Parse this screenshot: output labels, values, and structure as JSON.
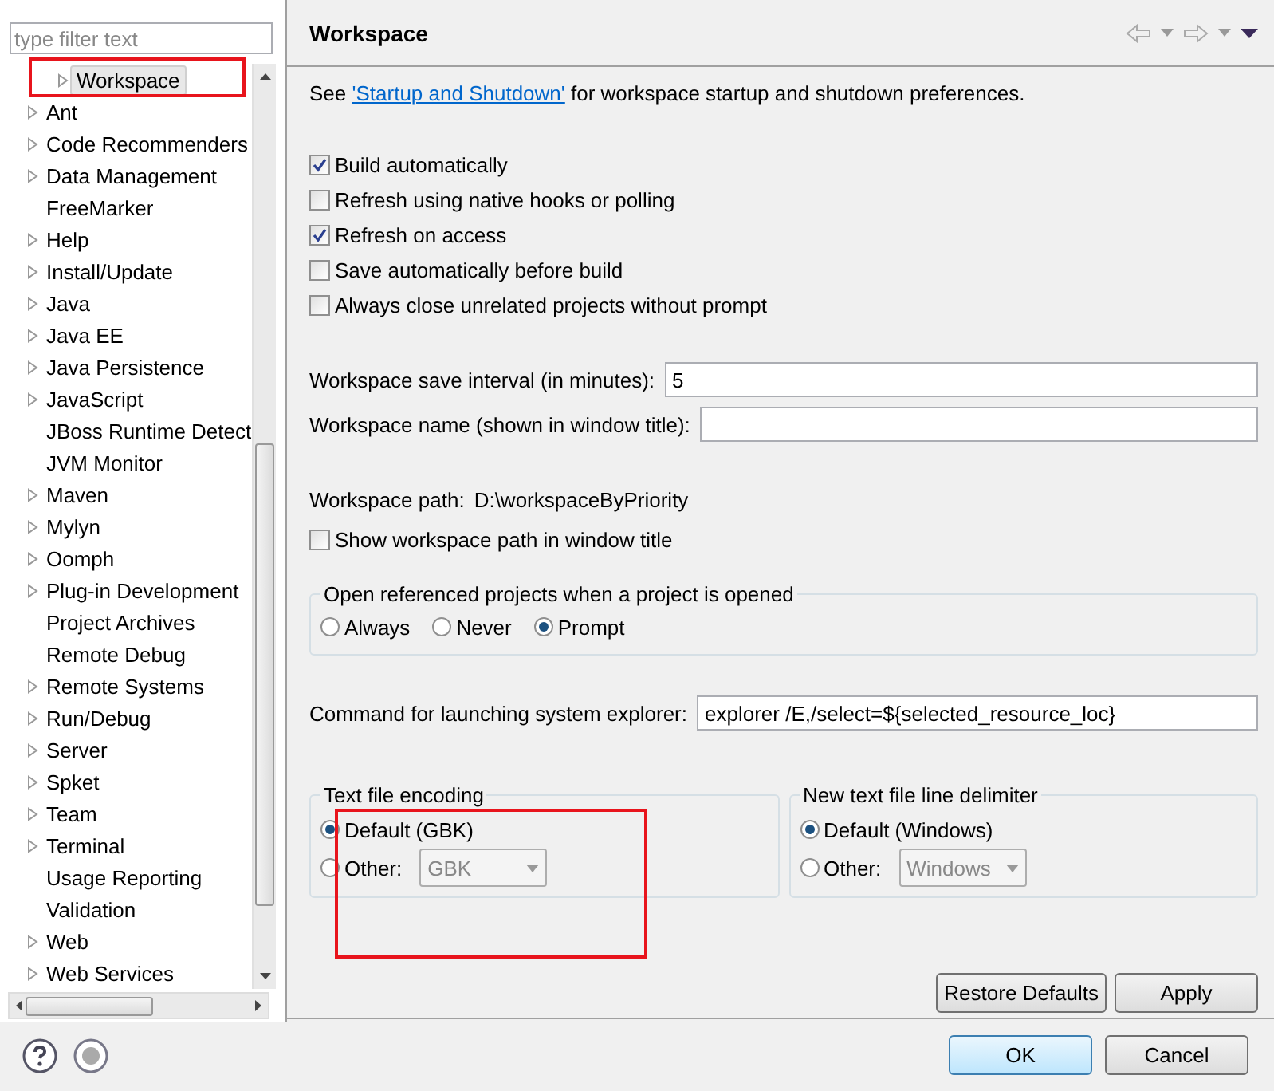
{
  "filter": {
    "placeholder": "type filter text"
  },
  "tree": [
    {
      "children": [
        {
          "label": "Workspace",
          "expandable": true,
          "selected": true
        }
      ]
    },
    {
      "label": "Ant",
      "expandable": true,
      "selected": false
    },
    {
      "label": "Code Recommenders",
      "expandable": true,
      "selected": false
    },
    {
      "label": "Data Management",
      "expandable": true,
      "selected": false
    },
    {
      "label": "FreeMarker",
      "expandable": false,
      "selected": false
    },
    {
      "label": "Help",
      "expandable": true,
      "selected": false
    },
    {
      "label": "Install/Update",
      "expandable": true,
      "selected": false
    },
    {
      "label": "Java",
      "expandable": true,
      "selected": false
    },
    {
      "label": "Java EE",
      "expandable": true,
      "selected": false
    },
    {
      "label": "Java Persistence",
      "expandable": true,
      "selected": false
    },
    {
      "label": "JavaScript",
      "expandable": true,
      "selected": false
    },
    {
      "label": "JBoss Runtime Detect",
      "expandable": false,
      "selected": false
    },
    {
      "label": "JVM Monitor",
      "expandable": false,
      "selected": false
    },
    {
      "label": "Maven",
      "expandable": true,
      "selected": false
    },
    {
      "label": "Mylyn",
      "expandable": true,
      "selected": false
    },
    {
      "label": "Oomph",
      "expandable": true,
      "selected": false
    },
    {
      "label": "Plug-in Development",
      "expandable": true,
      "selected": false
    },
    {
      "label": "Project Archives",
      "expandable": false,
      "selected": false
    },
    {
      "label": "Remote Debug",
      "expandable": false,
      "selected": false
    },
    {
      "label": "Remote Systems",
      "expandable": true,
      "selected": false
    },
    {
      "label": "Run/Debug",
      "expandable": true,
      "selected": false
    },
    {
      "label": "Server",
      "expandable": true,
      "selected": false
    },
    {
      "label": "Spket",
      "expandable": true,
      "selected": false
    },
    {
      "label": "Team",
      "expandable": true,
      "selected": false
    },
    {
      "label": "Terminal",
      "expandable": true,
      "selected": false
    },
    {
      "label": "Usage Reporting",
      "expandable": false,
      "selected": false
    },
    {
      "label": "Validation",
      "expandable": false,
      "selected": false
    },
    {
      "label": "Web",
      "expandable": true,
      "selected": false
    },
    {
      "label": "Web Services",
      "expandable": true,
      "selected": false
    }
  ],
  "page": {
    "title": "Workspace",
    "intro_before": "See",
    "intro_link": "'Startup and Shutdown'",
    "intro_after": "for workspace startup and shutdown preferences."
  },
  "options": [
    {
      "label": "Build automatically",
      "checked": true
    },
    {
      "label": "Refresh using native hooks or polling",
      "checked": false
    },
    {
      "label": "Refresh on access",
      "checked": true
    },
    {
      "label": "Save automatically before build",
      "checked": false
    },
    {
      "label": "Always close unrelated projects without prompt",
      "checked": false
    }
  ],
  "save_interval": {
    "label": "Workspace save interval (in minutes):",
    "value": "5"
  },
  "workspace_name": {
    "label": "Workspace name (shown in window title):"
  },
  "workspace_path": {
    "label": "Workspace path:",
    "value": "D:\\workspaceByPriority"
  },
  "show_path": {
    "label": "Show workspace path in window title",
    "checked": false
  },
  "open_referenced": {
    "title": "Open referenced projects when a project is opened",
    "choices": [
      {
        "label": "Always",
        "selected": false
      },
      {
        "label": "Never",
        "selected": false
      },
      {
        "label": "Prompt",
        "selected": true
      }
    ]
  },
  "explorer_command": {
    "label": "Command for launching system explorer:",
    "value": "explorer /E,/select=${selected_resource_loc}"
  },
  "encoding": {
    "title": "Text file encoding",
    "choices": [
      {
        "label": "Default (GBK)",
        "selected": true
      },
      {
        "label": "Other:",
        "selected": false
      }
    ],
    "other_value": "GBK",
    "other_disabled": true
  },
  "line_delimiter": {
    "title": "New text file line delimiter",
    "choices": [
      {
        "label": "Default (Windows)",
        "selected": true
      },
      {
        "label": "Other:",
        "selected": false
      }
    ],
    "other_value": "Windows",
    "other_disabled": true
  },
  "page_buttons": [
    "Restore Defaults",
    "Apply"
  ],
  "dialog_buttons": [
    {
      "label": "OK",
      "default": true
    },
    {
      "label": "Cancel",
      "default": false
    }
  ]
}
